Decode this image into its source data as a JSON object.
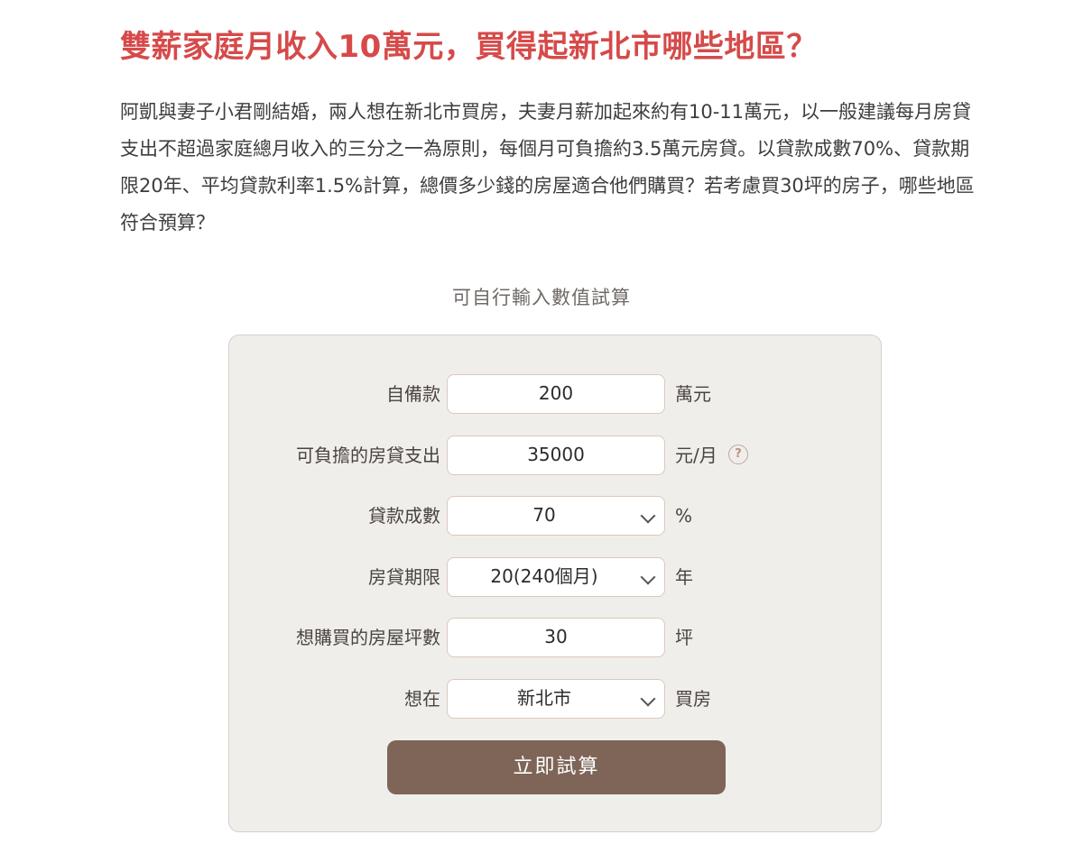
{
  "article": {
    "headline": "雙薪家庭月收入10萬元，買得起新北市哪些地區？",
    "intro": "阿凱與妻子小君剛結婚，兩人想在新北市買房，夫妻月薪加起來約有10-11萬元，以一般建議每月房貸支出不超過家庭總月收入的三分之一為原則，每個月可負擔約3.5萬元房貸。以貸款成數70%、貸款期限20年、平均貸款利率1.5%計算，總價多少錢的房屋適合他們購買？若考慮買30坪的房子，哪些地區符合預算？"
  },
  "calculator": {
    "caption": "可自行輸入數值試算",
    "down_payment": {
      "label": "自備款",
      "value": "200",
      "unit": "萬元"
    },
    "monthly_payment": {
      "label": "可負擔的房貸支出",
      "value": "35000",
      "unit": "元/月",
      "help_icon": "question-mark-icon",
      "help_glyph": "?"
    },
    "loan_ratio": {
      "label": "貸款成數",
      "selected": "70",
      "unit": "%"
    },
    "loan_term": {
      "label": "房貸期限",
      "selected": "20(240個月)",
      "unit": "年"
    },
    "floor_area": {
      "label": "想購買的房屋坪數",
      "value": "30",
      "unit": "坪"
    },
    "city": {
      "label": "想在",
      "selected": "新北市",
      "unit": "買房"
    },
    "submit_label": "立即試算"
  },
  "colors": {
    "headline": "#d64a4a",
    "panel_background": "#f0eeea",
    "panel_border": "#d8cfc8",
    "field_border": "#dcc8bb",
    "button_background": "#7e6558",
    "help_icon": "#c3a699"
  }
}
